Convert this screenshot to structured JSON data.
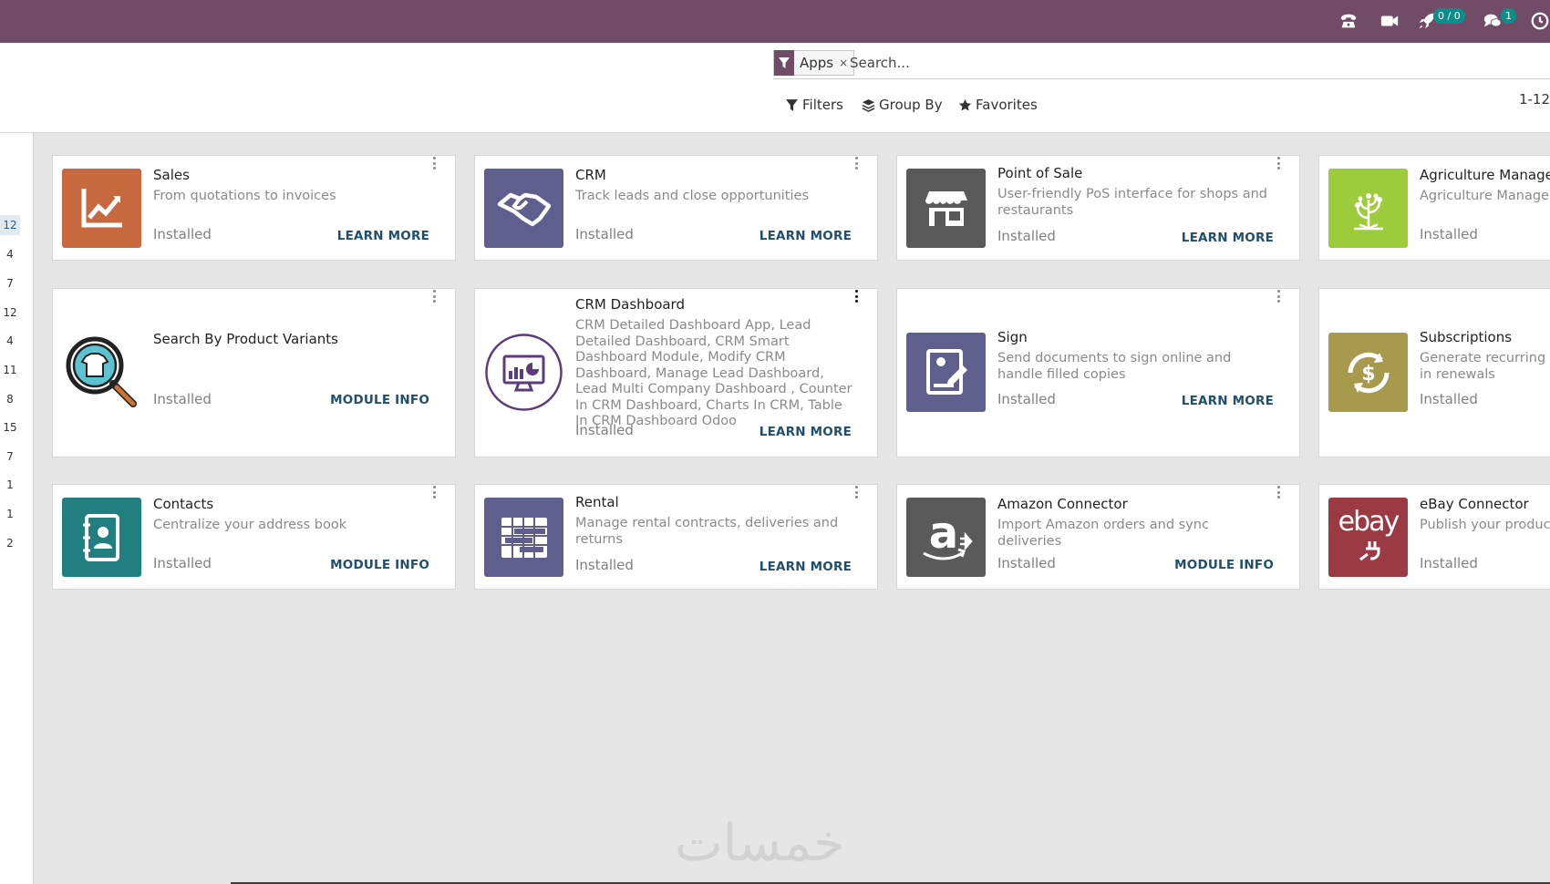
{
  "navbar": {
    "icons": [
      "phone-icon",
      "video-camera-icon",
      "rocket-icon",
      "chat-icon",
      "clock-icon"
    ],
    "rocket_badge": "0 / 0",
    "chat_badge": "1"
  },
  "search": {
    "facet_label": "Apps",
    "facet_close": "×",
    "placeholder": "Search..."
  },
  "toolbar": {
    "filters_label": "Filters",
    "groupby_label": "Group By",
    "favorites_label": "Favorites",
    "pager": "1-12"
  },
  "sidebar": {
    "counts": [
      "12",
      "4",
      "7",
      "12",
      "4",
      "11",
      "8",
      "15",
      "7",
      "1",
      "1",
      "2"
    ]
  },
  "cards": [
    {
      "title": "Sales",
      "summary": "From quotations to invoices",
      "status": "Installed",
      "link": "LEARN MORE",
      "icon": "sales-chart-icon",
      "color": "#c7693f"
    },
    {
      "title": "CRM",
      "summary": "Track leads and close opportunities",
      "status": "Installed",
      "link": "LEARN MORE",
      "icon": "handshake-icon",
      "color": "#5e5f8c"
    },
    {
      "title": "Point of Sale",
      "summary": "User-friendly PoS interface for shops and restaurants",
      "status": "Installed",
      "link": "LEARN MORE",
      "icon": "store-icon",
      "color": "#5a5a5a"
    },
    {
      "title": "Agriculture Managen",
      "summary": "Agriculture Managem",
      "status": "Installed",
      "link": "",
      "icon": "plant-icon",
      "color": "#9ccc3c"
    },
    {
      "title": "Search By Product Variants",
      "summary": "",
      "status": "Installed",
      "link": "MODULE INFO",
      "icon": "magnifier-shirt-icon",
      "color": "#ffffff"
    },
    {
      "title": "CRM Dashboard",
      "summary": "CRM Detailed Dashboard App, Lead Detailed Dashboard, CRM Smart Dashboard Module, Modify CRM Dashboard, Manage Lead Dashboard, Lead Multi Company Dashboard , Counter In CRM Dashboard, Charts In CRM, Table In CRM Dashboard Odoo",
      "status": "Installed",
      "link": "LEARN MORE",
      "icon": "monitor-chart-icon",
      "color": "#ffffff"
    },
    {
      "title": "Sign",
      "summary": "Send documents to sign online and handle filled copies",
      "status": "Installed",
      "link": "LEARN MORE",
      "icon": "sign-document-icon",
      "color": "#5e5f8c"
    },
    {
      "title": "Subscriptions",
      "summary": "Generate recurring in renewals",
      "status": "Installed",
      "link": "",
      "icon": "recurring-dollar-icon",
      "color": "#a79a4c"
    },
    {
      "title": "Contacts",
      "summary": "Centralize your address book",
      "status": "Installed",
      "link": "MODULE INFO",
      "icon": "address-book-icon",
      "color": "#21807f"
    },
    {
      "title": "Rental",
      "summary": "Manage rental contracts, deliveries and returns",
      "status": "Installed",
      "link": "LEARN MORE",
      "icon": "calendar-table-icon",
      "color": "#5e5f8c"
    },
    {
      "title": "Amazon Connector",
      "summary": "Import Amazon orders and sync deliveries",
      "status": "Installed",
      "link": "MODULE INFO",
      "icon": "amazon-icon",
      "color": "#5a5a5a"
    },
    {
      "title": "eBay Connector",
      "summary": "Publish your product",
      "status": "Installed",
      "link": "",
      "icon": "ebay-icon",
      "color": "#9c3a43",
      "icon_text": "ebay"
    }
  ],
  "watermark": "خمسات"
}
